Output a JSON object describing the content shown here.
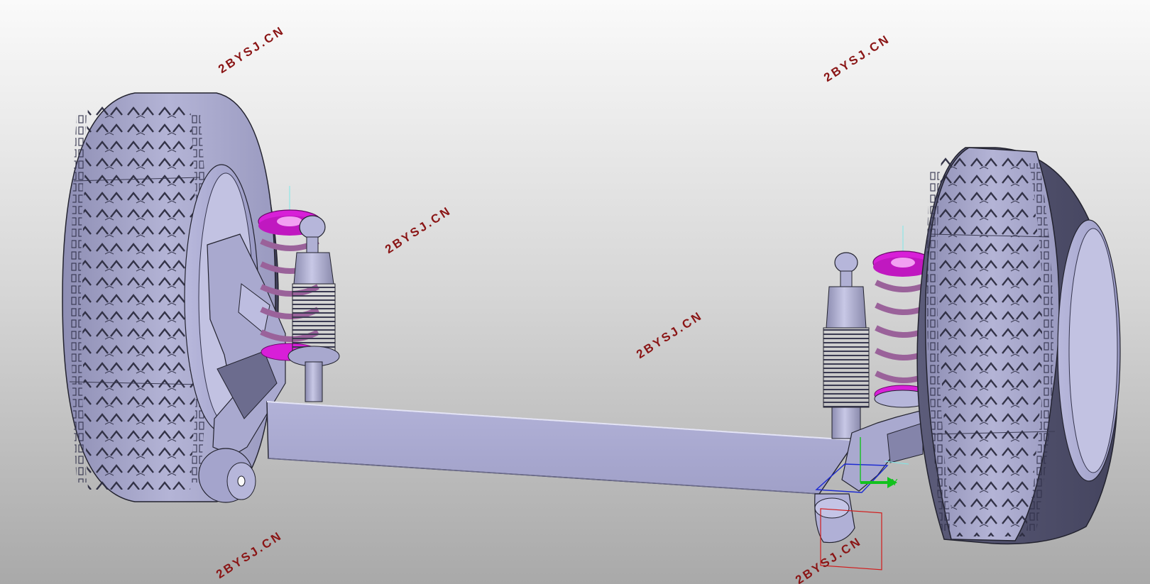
{
  "viewport": {
    "background_top": "#fafafa",
    "background_bottom": "#a9a9a9",
    "part_color": "#a9a9cf",
    "spring_seat_color": "#d81fd8",
    "spring_color": "#a06aa0"
  },
  "watermarks": [
    "2BYSJ.CN",
    "2BYSJ.CN",
    "2BYSJ.CN",
    "2BYSJ.CN",
    "2BYSJ.CN",
    "2BYSJ.CN"
  ],
  "watermark_color": "#8a1515",
  "triad": {
    "y_label": "Y",
    "color": "#12c21e",
    "icon": "compass-triad-icon"
  },
  "model": {
    "parts": [
      "left-tire",
      "left-wheel-rim",
      "left-knuckle",
      "left-coil-spring",
      "left-shock-absorber",
      "axle-beam",
      "right-trailing-arm",
      "right-coil-spring",
      "right-shock-absorber",
      "right-tire",
      "right-wheel-rim"
    ]
  }
}
